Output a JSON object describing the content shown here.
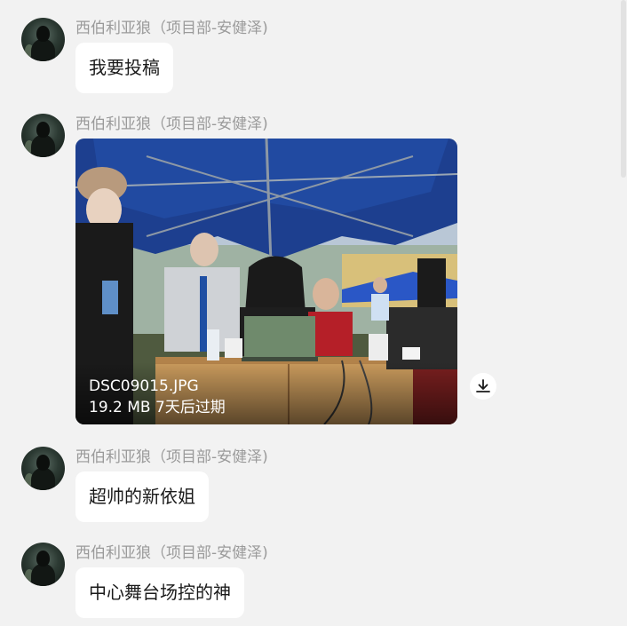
{
  "messages": [
    {
      "sender": "西伯利亚狼（项目部-安健泽)",
      "type": "text",
      "text": "我要投稿"
    },
    {
      "sender": "西伯利亚狼（项目部-安健泽)",
      "type": "file",
      "file": {
        "name": "DSC09015.JPG",
        "meta": "19.2 MB 7天后过期"
      },
      "icons": {
        "download": "download-icon"
      }
    },
    {
      "sender": "西伯利亚狼（项目部-安健泽)",
      "type": "text",
      "text": "超帅的新依姐"
    },
    {
      "sender": "西伯利亚狼（项目部-安健泽)",
      "type": "text",
      "text": "中心舞台场控的神"
    }
  ],
  "colors": {
    "background": "#f2f2f2",
    "bubble": "#ffffff",
    "sender": "#9a9a9a",
    "text": "#1a1a1a",
    "tent": "#1d3f8f"
  }
}
